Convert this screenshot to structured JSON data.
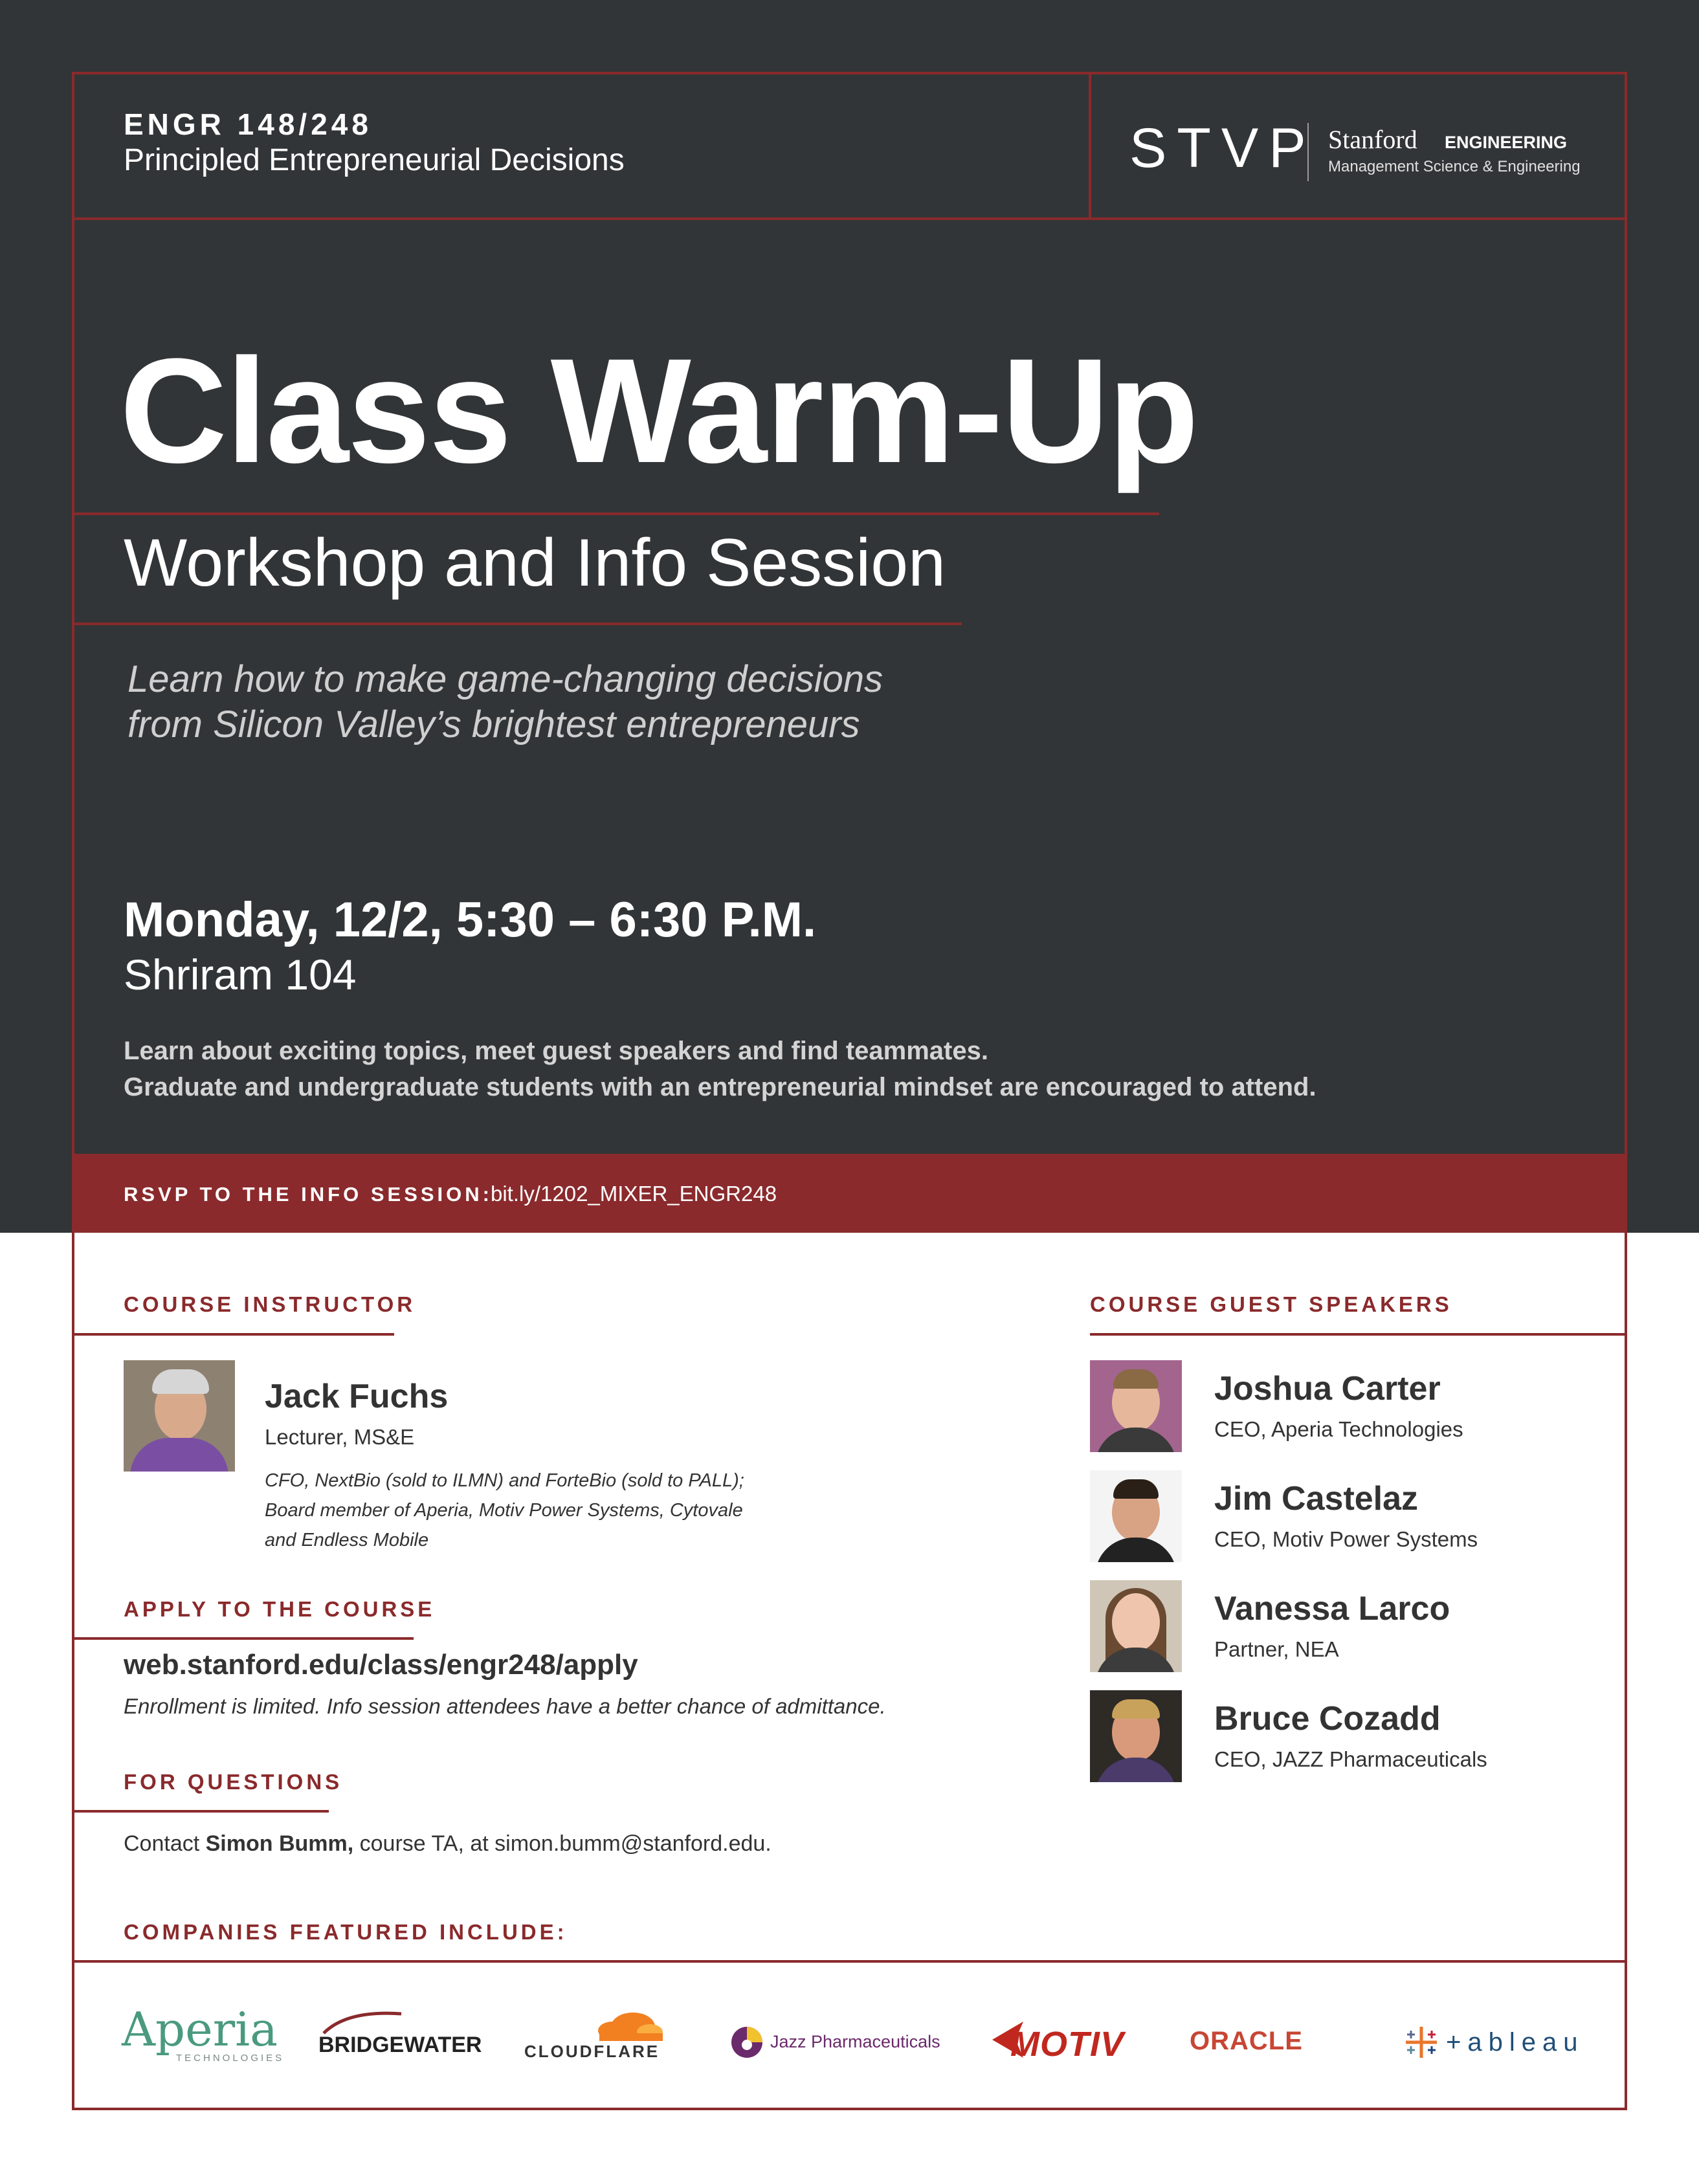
{
  "header": {
    "course_code": "ENGR 148/248",
    "course_name": "Principled Entrepreneurial Decisions",
    "stvp": "STVP",
    "stanford": "Stanford",
    "engineering": "ENGINEERING",
    "department": "Management Science & Engineering"
  },
  "hero": {
    "title": "Class Warm-Up",
    "subtitle": "Workshop and Info Session",
    "tagline_1": "Learn how to make game-changing decisions",
    "tagline_2": "from Silicon Valley’s brightest entrepreneurs",
    "datetime": "Monday, 12/2, 5:30 – 6:30 P.M.",
    "location": "Shriram 104",
    "blurb_1": "Learn about exciting topics, meet guest speakers and find teammates.",
    "blurb_2": "Graduate and undergraduate students with an entrepreneurial mindset are encouraged to attend."
  },
  "rsvp": {
    "label": "RSVP TO THE INFO SESSION:",
    "url": "bit.ly/1202_MIXER_ENGR248"
  },
  "instructor": {
    "heading": "COURSE INSTRUCTOR",
    "name": "Jack Fuchs",
    "role": "Lecturer, MS&E",
    "bio_1": "CFO, NextBio (sold to ILMN) and ForteBio (sold to PALL);",
    "bio_2": "Board member of Aperia, Motiv Power Systems, Cytovale",
    "bio_3": "and Endless Mobile"
  },
  "apply": {
    "heading": "APPLY TO THE COURSE",
    "url": "web.stanford.edu/class/engr248/apply",
    "note": "Enrollment is limited. Info session attendees have a better chance of admittance."
  },
  "questions": {
    "heading": "FOR QUESTIONS",
    "prefix": "Contact ",
    "ta_name": "Simon Bumm,",
    "suffix": " course TA, at simon.bumm@stanford.edu."
  },
  "speakers": {
    "heading": "COURSE GUEST SPEAKERS",
    "list": [
      {
        "name": "Joshua Carter",
        "role": "CEO, Aperia Technologies"
      },
      {
        "name": "Jim Castelaz",
        "role": "CEO, Motiv Power Systems"
      },
      {
        "name": "Vanessa Larco",
        "role": "Partner, NEA"
      },
      {
        "name": "Bruce Cozadd",
        "role": "CEO, JAZZ Pharmaceuticals"
      }
    ]
  },
  "companies": {
    "heading": "COMPANIES FEATURED INCLUDE:",
    "aperia": "Aperia",
    "aperia_sub": "TECHNOLOGIES",
    "bridgewater": "BRIDGEWATER",
    "cloudflare": "CLOUDFLARE",
    "jazz": "Jazz Pharmaceuticals",
    "motiv": "MOTIV",
    "oracle": "ORACLE",
    "tableau": "+ableau",
    "colors": {
      "aperia": "#4a9a7e",
      "cloudflare": "#f38020",
      "jazz": "#6b2a6b",
      "motiv": "#c0281f",
      "oracle": "#c74634",
      "tableau": "#1f4e79"
    }
  }
}
